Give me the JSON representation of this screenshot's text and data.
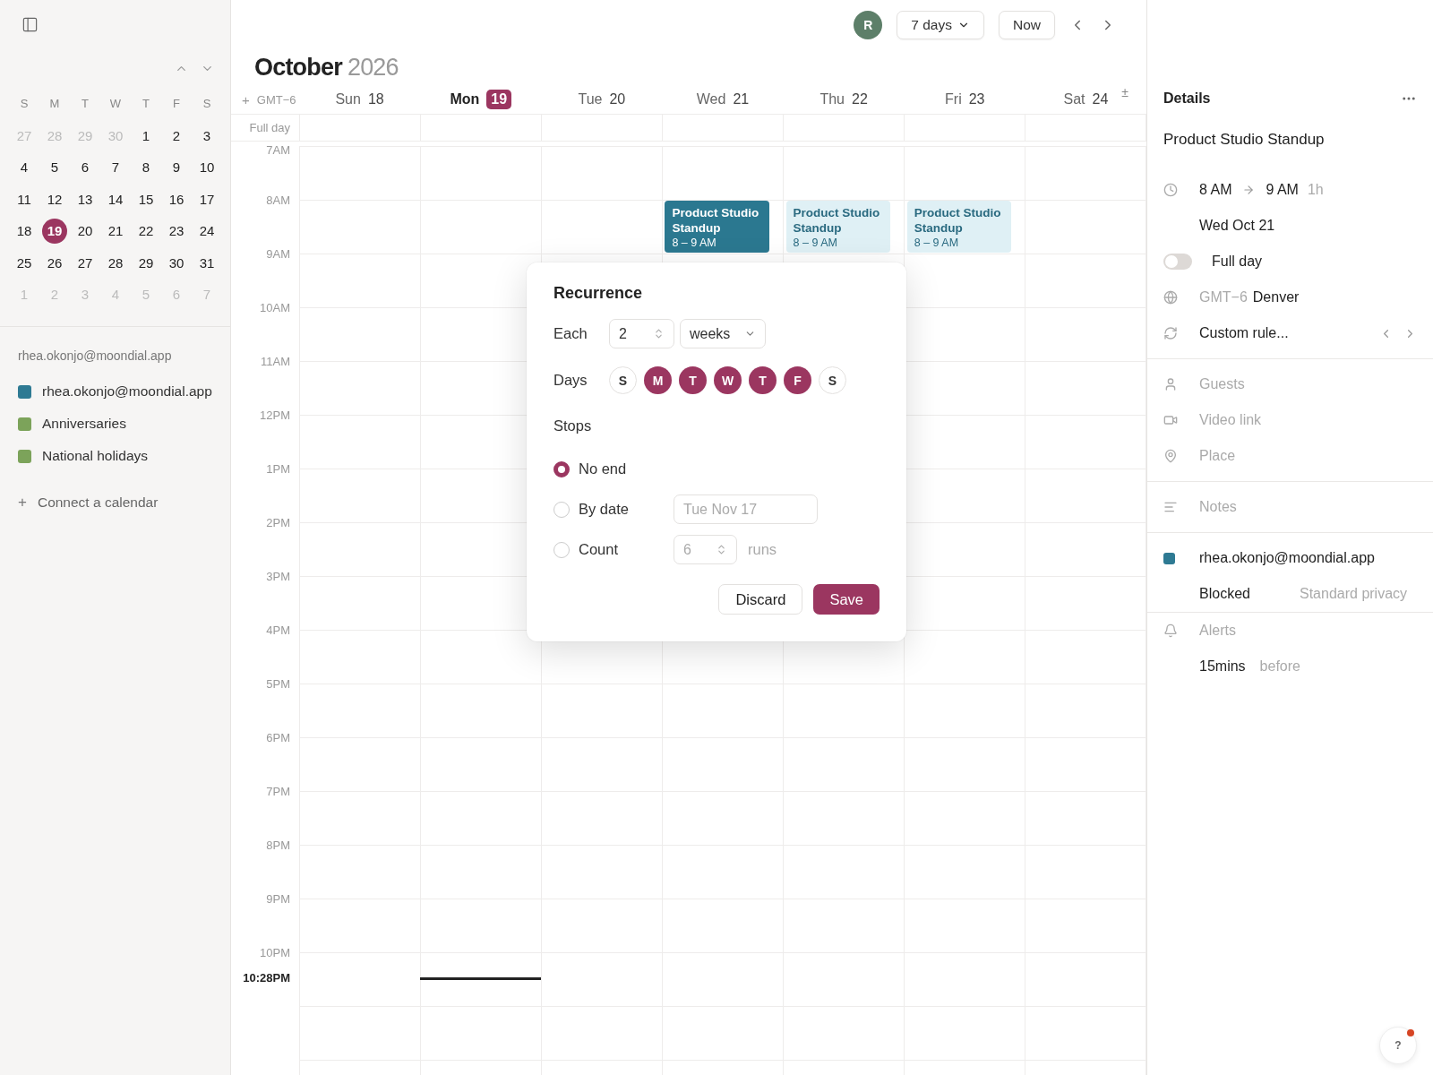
{
  "sidebar": {
    "mini_calendar": {
      "weekdays": [
        "S",
        "M",
        "T",
        "W",
        "T",
        "F",
        "S"
      ],
      "weeks": [
        [
          {
            "day": "27",
            "muted": true,
            "selected": false
          },
          {
            "day": "28",
            "muted": true,
            "selected": false
          },
          {
            "day": "29",
            "muted": true,
            "selected": false
          },
          {
            "day": "30",
            "muted": true,
            "selected": false
          },
          {
            "day": "1",
            "muted": false,
            "selected": false
          },
          {
            "day": "2",
            "muted": false,
            "selected": false
          },
          {
            "day": "3",
            "muted": false,
            "selected": false
          }
        ],
        [
          {
            "day": "4",
            "muted": false,
            "selected": false
          },
          {
            "day": "5",
            "muted": false,
            "selected": false
          },
          {
            "day": "6",
            "muted": false,
            "selected": false
          },
          {
            "day": "7",
            "muted": false,
            "selected": false
          },
          {
            "day": "8",
            "muted": false,
            "selected": false
          },
          {
            "day": "9",
            "muted": false,
            "selected": false
          },
          {
            "day": "10",
            "muted": false,
            "selected": false
          }
        ],
        [
          {
            "day": "11",
            "muted": false,
            "selected": false
          },
          {
            "day": "12",
            "muted": false,
            "selected": false
          },
          {
            "day": "13",
            "muted": false,
            "selected": false
          },
          {
            "day": "14",
            "muted": false,
            "selected": false
          },
          {
            "day": "15",
            "muted": false,
            "selected": false
          },
          {
            "day": "16",
            "muted": false,
            "selected": false
          },
          {
            "day": "17",
            "muted": false,
            "selected": false
          }
        ],
        [
          {
            "day": "18",
            "muted": false,
            "selected": false
          },
          {
            "day": "19",
            "muted": false,
            "selected": true
          },
          {
            "day": "20",
            "muted": false,
            "selected": false
          },
          {
            "day": "21",
            "muted": false,
            "selected": false
          },
          {
            "day": "22",
            "muted": false,
            "selected": false
          },
          {
            "day": "23",
            "muted": false,
            "selected": false
          },
          {
            "day": "24",
            "muted": false,
            "selected": false
          }
        ],
        [
          {
            "day": "25",
            "muted": false,
            "selected": false
          },
          {
            "day": "26",
            "muted": false,
            "selected": false
          },
          {
            "day": "27",
            "muted": false,
            "selected": false
          },
          {
            "day": "28",
            "muted": false,
            "selected": false
          },
          {
            "day": "29",
            "muted": false,
            "selected": false
          },
          {
            "day": "30",
            "muted": false,
            "selected": false
          },
          {
            "day": "31",
            "muted": false,
            "selected": false
          }
        ],
        [
          {
            "day": "1",
            "muted": true,
            "selected": false
          },
          {
            "day": "2",
            "muted": true,
            "selected": false
          },
          {
            "day": "3",
            "muted": true,
            "selected": false
          },
          {
            "day": "4",
            "muted": true,
            "selected": false
          },
          {
            "day": "5",
            "muted": true,
            "selected": false
          },
          {
            "day": "6",
            "muted": true,
            "selected": false
          },
          {
            "day": "7",
            "muted": true,
            "selected": false
          }
        ]
      ]
    },
    "account": "rhea.okonjo@moondial.app",
    "calendars": [
      {
        "name": "rhea.okonjo@moondial.app",
        "color": "#2e7a93"
      },
      {
        "name": "Anniversaries",
        "color": "#7ca35a"
      },
      {
        "name": "National holidays",
        "color": "#7ca35a"
      }
    ],
    "connect": {
      "icon": "+",
      "label": "Connect a calendar"
    }
  },
  "toolbar": {
    "avatar": "R",
    "view": "7 days",
    "now": "Now"
  },
  "title": {
    "month": "October",
    "year": "2026"
  },
  "week": {
    "add": "+",
    "timezone": "GMT−6",
    "expand": "±",
    "full_day": "Full day",
    "days": [
      {
        "name": "Sun",
        "date": "18",
        "selected": false
      },
      {
        "name": "Mon",
        "date": "19",
        "selected": true
      },
      {
        "name": "Tue",
        "date": "20",
        "selected": false
      },
      {
        "name": "Wed",
        "date": "21",
        "selected": false
      },
      {
        "name": "Thu",
        "date": "22",
        "selected": false
      },
      {
        "name": "Fri",
        "date": "23",
        "selected": false
      },
      {
        "name": "Sat",
        "date": "24",
        "selected": false
      }
    ],
    "hours": [
      {
        "label": "7AM"
      },
      {
        "label": "8AM",
        "cells": [
          {},
          {},
          {},
          {
            "event": {
              "title": "Product Studio Standup",
              "time": "8 – 9 AM",
              "selected": true
            }
          },
          {
            "event": {
              "title": "Product Studio Standup",
              "time": "8 – 9 AM",
              "selected": false
            }
          },
          {
            "event": {
              "title": "Product Studio Standup",
              "time": "8 – 9 AM",
              "selected": false
            }
          },
          {}
        ]
      },
      {
        "label": "9AM"
      },
      {
        "label": "10AM"
      },
      {
        "label": "11AM"
      },
      {
        "label": "12PM"
      },
      {
        "label": "1PM"
      },
      {
        "label": "2PM"
      },
      {
        "label": "3PM"
      },
      {
        "label": "4PM"
      },
      {
        "label": "5PM"
      },
      {
        "label": "6PM"
      },
      {
        "label": "7PM"
      },
      {
        "label": "8PM"
      },
      {
        "label": "9PM"
      },
      {
        "label": "10PM",
        "now": {
          "label": "10:28PM"
        }
      }
    ]
  },
  "recurrence": {
    "title": "Recurrence",
    "each": {
      "label": "Each",
      "count": "2",
      "unit": "weeks"
    },
    "days": {
      "label": "Days",
      "options": [
        {
          "letter": "S",
          "selected": false
        },
        {
          "letter": "M",
          "selected": true
        },
        {
          "letter": "T",
          "selected": true
        },
        {
          "letter": "W",
          "selected": true
        },
        {
          "letter": "T",
          "selected": true
        },
        {
          "letter": "F",
          "selected": true
        },
        {
          "letter": "S",
          "selected": false
        }
      ]
    },
    "stops": {
      "label": "Stops",
      "options": [
        {
          "label": "No end",
          "selected": true,
          "kind": "plain"
        },
        {
          "label": "By date",
          "selected": false,
          "kind": "date",
          "value": "Tue Nov 17",
          "disabled": true
        },
        {
          "label": "Count",
          "selected": false,
          "kind": "count",
          "value": "6",
          "suffix": "runs",
          "disabled": true
        }
      ]
    },
    "buttons": [
      {
        "label": "Discard",
        "kind": "secondary"
      },
      {
        "label": "Save",
        "kind": "primary"
      }
    ]
  },
  "details": {
    "title": "Details",
    "event_title": "Product Studio Standup",
    "time": {
      "start": "8 AM",
      "end": "9 AM",
      "duration": "1h"
    },
    "date": "Wed Oct 21",
    "full_day": {
      "label": "Full day",
      "on": false
    },
    "timezone": {
      "offset": "GMT−6",
      "city": "Denver"
    },
    "repeat": "Custom rule...",
    "guests": "Guests",
    "video": "Video link",
    "place": "Place",
    "notes": "Notes",
    "calendar": {
      "name": "rhea.okonjo@moondial.app",
      "color": "#2e7a93"
    },
    "availability": "Blocked",
    "privacy": "Standard privacy",
    "alerts": "Alerts",
    "alert": {
      "amount": "15mins",
      "when": "before"
    }
  },
  "help": {
    "label": "?",
    "unread": true
  }
}
